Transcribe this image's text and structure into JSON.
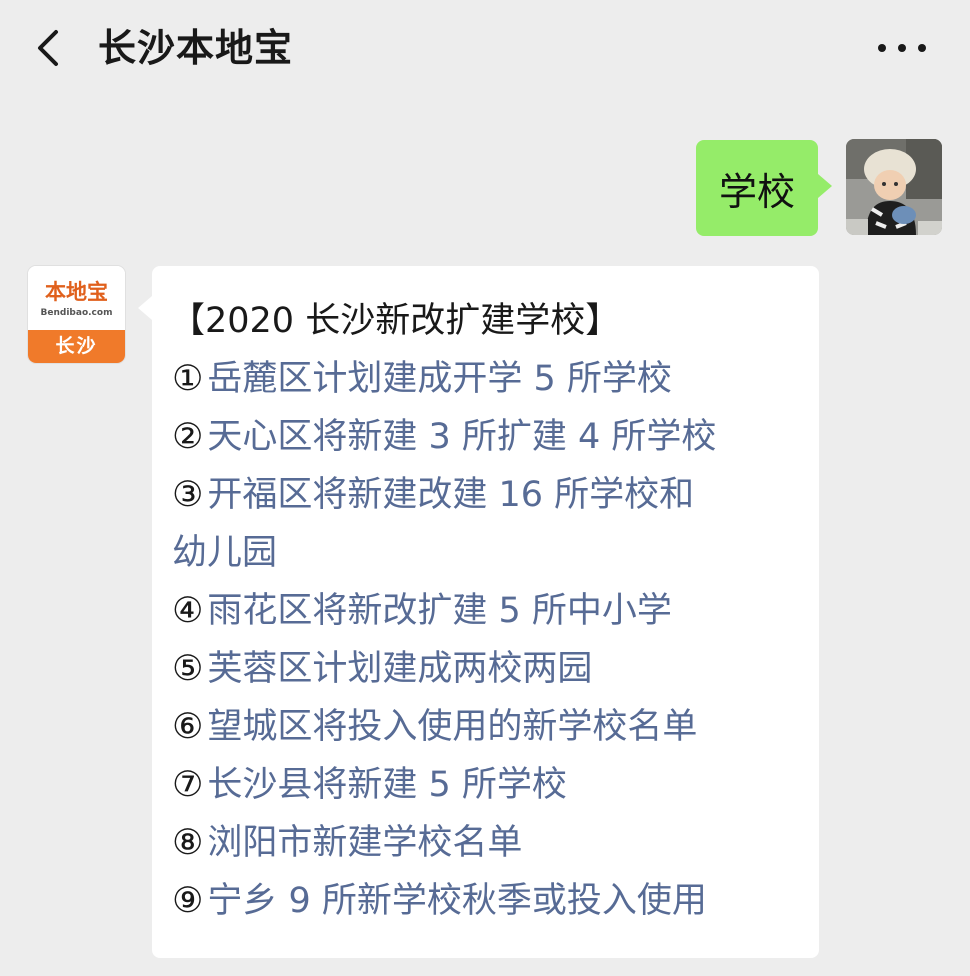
{
  "header": {
    "back_icon": "chevron-left-icon",
    "title": "长沙本地宝",
    "more_icon": "more-dots-icon"
  },
  "user_message": {
    "text": "学校",
    "bubble_color": "#95ec69"
  },
  "bot": {
    "logo_brand": "本地宝",
    "logo_domain": "Bendibao.com",
    "logo_city": "长沙",
    "brand_color": "#f07a2a"
  },
  "reply": {
    "heading": "【2020 长沙新改扩建学校】",
    "link_color": "#576b95",
    "items": [
      {
        "num": "①",
        "text": "岳麓区计划建成开学 5 所学校"
      },
      {
        "num": "②",
        "text": "天心区将新建 3 所扩建 4 所学校"
      },
      {
        "num": "③",
        "text": "开福区将新建改建 16 所学校和",
        "cont": "幼儿园"
      },
      {
        "num": "④",
        "text": "雨花区将新改扩建 5 所中小学"
      },
      {
        "num": "⑤",
        "text": "芙蓉区计划建成两校两园"
      },
      {
        "num": "⑥",
        "text": "望城区将投入使用的新学校名单"
      },
      {
        "num": "⑦",
        "text": "长沙县将新建 5 所学校"
      },
      {
        "num": "⑧",
        "text": "浏阳市新建学校名单"
      },
      {
        "num": "⑨",
        "text": "宁乡 9 所新学校秋季或投入使用"
      }
    ]
  }
}
